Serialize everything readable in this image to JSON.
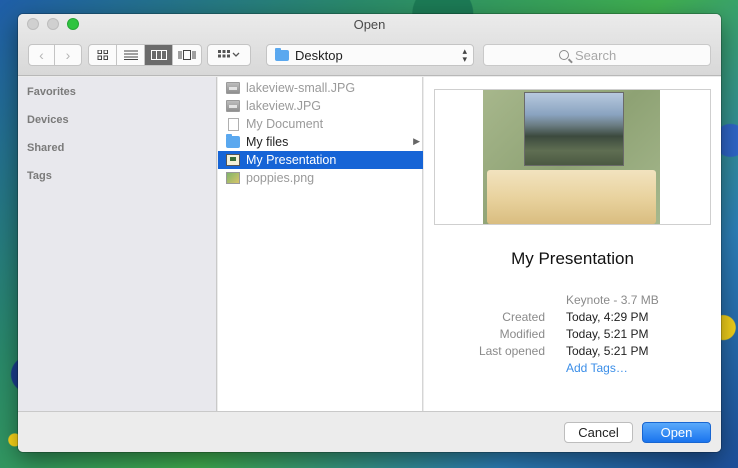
{
  "window": {
    "title": "Open"
  },
  "toolbar": {
    "back_icon": "chevron-left",
    "forward_icon": "chevron-right",
    "view_modes": [
      "icon-view",
      "list-view",
      "column-view",
      "cover-flow-view"
    ],
    "active_view": "column-view",
    "arrange_icon": "grid-arrange",
    "location": "Desktop",
    "search_placeholder": "Search"
  },
  "sidebar": {
    "sections": [
      {
        "label": "Favorites"
      },
      {
        "label": "Devices"
      },
      {
        "label": "Shared"
      },
      {
        "label": "Tags"
      }
    ]
  },
  "files": [
    {
      "name": "lakeview-small.JPG",
      "icon": "image-file-icon",
      "dim": true
    },
    {
      "name": "lakeview.JPG",
      "icon": "image-file-icon",
      "dim": true
    },
    {
      "name": "My Document",
      "icon": "document-icon",
      "dim": true
    },
    {
      "name": "My files",
      "icon": "folder-icon",
      "dim": false,
      "has_children": true
    },
    {
      "name": "My Presentation",
      "icon": "keynote-icon",
      "dim": false,
      "selected": true
    },
    {
      "name": "poppies.png",
      "icon": "png-file-icon",
      "dim": true
    }
  ],
  "preview": {
    "name": "My Presentation",
    "kind": "Keynote - 3.7 MB",
    "created_label": "Created",
    "created_value": "Today, 4:29 PM",
    "modified_label": "Modified",
    "modified_value": "Today, 5:21 PM",
    "last_opened_label": "Last opened",
    "last_opened_value": "Today, 5:21 PM",
    "add_tags": "Add Tags…"
  },
  "footer": {
    "cancel_label": "Cancel",
    "open_label": "Open"
  },
  "colors": {
    "selection": "#1664d6",
    "primary_button": "#1a74ee",
    "link": "#3b8ee8"
  }
}
